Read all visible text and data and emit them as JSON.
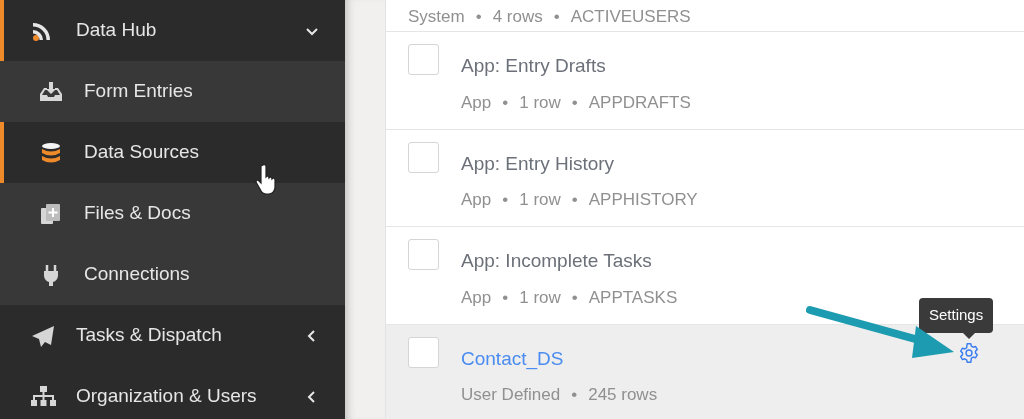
{
  "sidebar": {
    "items": [
      {
        "label": "Data Hub",
        "kind": "rss",
        "active": true,
        "expanded": true,
        "children": [
          {
            "label": "Form Entries",
            "kind": "inbox",
            "selected": false
          },
          {
            "label": "Data Sources",
            "kind": "database",
            "selected": true
          },
          {
            "label": "Files & Docs",
            "kind": "files",
            "selected": false
          },
          {
            "label": "Connections",
            "kind": "plug",
            "selected": false
          }
        ]
      },
      {
        "label": "Tasks & Dispatch",
        "kind": "plane",
        "active": false,
        "expanded": false
      },
      {
        "label": "Organization & Users",
        "kind": "sitemap",
        "active": false,
        "expanded": false
      }
    ]
  },
  "separator": "•",
  "data_sources": [
    {
      "meta": [
        "System",
        "4 rows",
        "ACTIVEUSERS"
      ],
      "highlighted": false
    },
    {
      "title": "App: Entry Drafts",
      "meta": [
        "App",
        "1 row",
        "APPDRAFTS"
      ],
      "checked": false,
      "kind": "app",
      "highlighted": false
    },
    {
      "title": "App: Entry History",
      "meta": [
        "App",
        "1 row",
        "APPHISTORY"
      ],
      "checked": false,
      "kind": "app",
      "highlighted": false
    },
    {
      "title": "App: Incomplete Tasks",
      "meta": [
        "App",
        "1 row",
        "APPTASKS"
      ],
      "checked": false,
      "kind": "app",
      "highlighted": false
    },
    {
      "title": "Contact_DS",
      "meta": [
        "User Defined",
        "245 rows"
      ],
      "checked": false,
      "kind": "user",
      "highlighted": true
    }
  ],
  "tooltip": {
    "text": "Settings"
  }
}
